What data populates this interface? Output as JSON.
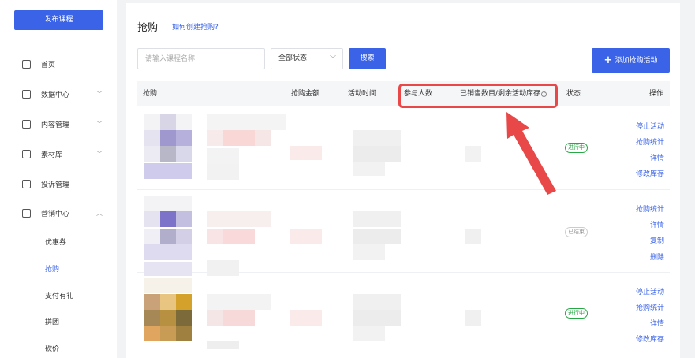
{
  "sidebar": {
    "publish_label": "发布课程",
    "items": [
      {
        "label": "首页",
        "icon": "home-icon"
      },
      {
        "label": "数据中心",
        "icon": "chart-icon",
        "chevron": "﹀"
      },
      {
        "label": "内容管理",
        "icon": "content-icon",
        "chevron": "﹀"
      },
      {
        "label": "素材库",
        "icon": "folder-icon",
        "chevron": "﹀"
      },
      {
        "label": "投诉管理",
        "icon": "complaint-icon"
      },
      {
        "label": "营销中心",
        "icon": "marketing-icon",
        "chevron": "︿"
      }
    ],
    "sub_items": [
      {
        "label": "优惠券"
      },
      {
        "label": "抢购",
        "active": true
      },
      {
        "label": "支付有礼"
      },
      {
        "label": "拼团"
      },
      {
        "label": "砍价"
      }
    ]
  },
  "header": {
    "title": "抢购",
    "howto_link": "如何创建抢购?"
  },
  "toolbar": {
    "search_placeholder": "请输入课程名称",
    "status_value": "全部状态",
    "status_chevron": "﹀",
    "search_label": "搜索",
    "add_label": "添加抢购活动",
    "add_plus": "+"
  },
  "table": {
    "columns": [
      "抢购",
      "抢购金额",
      "活动时间",
      "参与人数",
      "已销售数目/剩余活动库存",
      "状态",
      "操作"
    ],
    "help_glyph": "?",
    "rows": [
      {
        "status": "进行中",
        "status_type": "running",
        "actions": [
          "停止活动",
          "抢购统计",
          "详情",
          "修改库存"
        ]
      },
      {
        "status": "已结束",
        "status_type": "ended",
        "actions": [
          "抢购统计",
          "详情",
          "复制",
          "删除"
        ]
      },
      {
        "status": "进行中",
        "status_type": "running",
        "actions": [
          "停止活动",
          "抢购统计",
          "详情",
          "修改库存"
        ]
      }
    ]
  },
  "colors": {
    "accent": "#3a63e8",
    "running": "#28a745",
    "annotation": "#e84848"
  }
}
